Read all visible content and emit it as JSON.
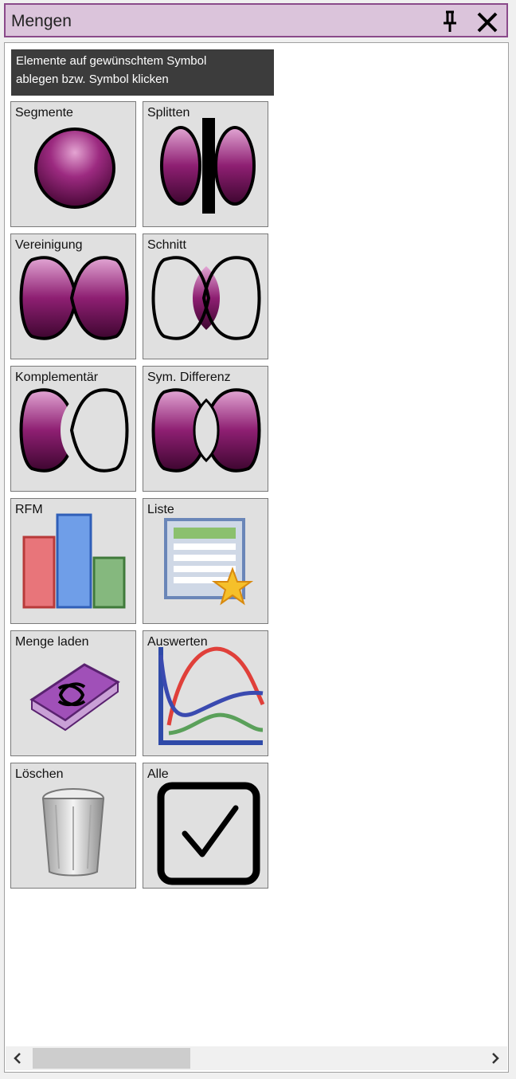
{
  "window": {
    "title": "Mengen",
    "pin_icon": "pin-icon",
    "close_icon": "close-icon"
  },
  "hint": {
    "line1": "Elemente auf gewünschtem Symbol",
    "line2": "ablegen bzw. Symbol klicken"
  },
  "tiles": [
    {
      "label": "Segmente",
      "icon": "segment-circle-icon"
    },
    {
      "label": "Splitten",
      "icon": "split-icon"
    },
    {
      "label": "Vereinigung",
      "icon": "union-icon"
    },
    {
      "label": "Schnitt",
      "icon": "intersection-icon"
    },
    {
      "label": "Komplementär",
      "icon": "complement-icon"
    },
    {
      "label": "Sym. Differenz",
      "icon": "symmetric-difference-icon"
    },
    {
      "label": "RFM",
      "icon": "rfm-bar-chart-icon"
    },
    {
      "label": "Liste",
      "icon": "list-table-star-icon"
    },
    {
      "label": "Menge laden",
      "icon": "load-folder-icon"
    },
    {
      "label": "Auswerten",
      "icon": "evaluate-chart-icon"
    },
    {
      "label": "Löschen",
      "icon": "trash-can-icon"
    },
    {
      "label": "Alle",
      "icon": "checkbox-checked-icon"
    }
  ],
  "colors": {
    "accent": "#8a4a8a",
    "title_bg": "#dbc4db",
    "set_fill": "#8b1a6e",
    "hint_bg": "#3c3c3c"
  },
  "scrollbar": {
    "left_icon": "chevron-left-icon",
    "right_icon": "chevron-right-icon"
  }
}
